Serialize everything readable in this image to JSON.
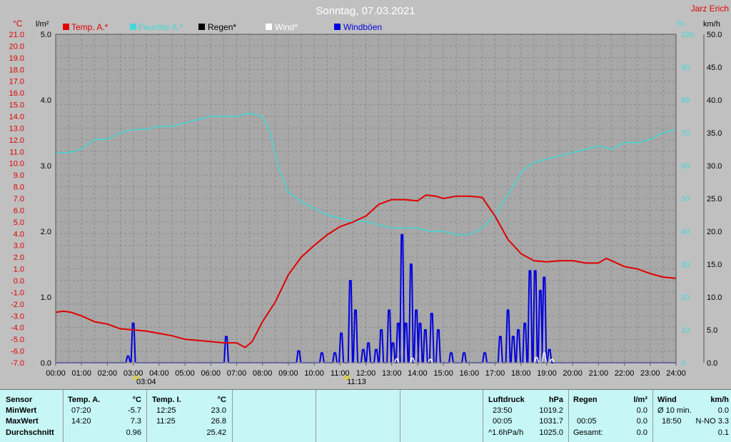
{
  "header": {
    "title": "Sonntag, 07.03.2021",
    "author": "Jarz Erich",
    "left_unit_temp": "°C",
    "left_unit_rain": "l/m²",
    "right_unit_hum": "%",
    "right_unit_wind": "km/h"
  },
  "legend": [
    {
      "label": "Temp. A.*",
      "color": "#e00000"
    },
    {
      "label": "Feuchte A.*",
      "color": "#40d8d8"
    },
    {
      "label": "Regen*",
      "color": "#000000"
    },
    {
      "label": "Wind*",
      "color": "#ffffff"
    },
    {
      "label": "Windböen",
      "color": "#0000dd"
    }
  ],
  "colors": {
    "plot_background": "#a8a8a8",
    "temperature": "#e00000",
    "humidity": "#40d8d8",
    "gusts": "#0000dd",
    "wind": "#ffffff",
    "table_background": "#c6f6f6"
  },
  "chart_data": {
    "type": "line",
    "title": "Sonntag, 07.03.2021",
    "x_ticks": [
      "00:00",
      "01:00",
      "02:00",
      "03:00",
      "04:00",
      "05:00",
      "06:00",
      "07:00",
      "08:00",
      "09:00",
      "10:00",
      "11:00",
      "12:00",
      "13:00",
      "14:00",
      "15:00",
      "16:00",
      "17:00",
      "18:00",
      "19:00",
      "20:00",
      "21:00",
      "22:00",
      "23:00",
      "24:00"
    ],
    "temp_ticks": [
      "21.0",
      "20.0",
      "19.0",
      "18.0",
      "17.0",
      "16.0",
      "15.0",
      "14.0",
      "13.0",
      "12.0",
      "11.0",
      "10.0",
      "9.0",
      "8.0",
      "7.0",
      "6.0",
      "5.0",
      "4.0",
      "3.0",
      "2.0",
      "1.0",
      "0.0",
      "-1.0",
      "-2.0",
      "-3.0",
      "-4.0",
      "-5.0",
      "-6.0",
      "-7.0"
    ],
    "rain_ticks": [
      "5.0",
      "4.0",
      "3.0",
      "2.0",
      "1.0",
      "0.0"
    ],
    "hum_ticks": [
      "100",
      "90",
      "80",
      "70",
      "60",
      "50",
      "40",
      "30",
      "20",
      "10",
      "0"
    ],
    "wind_ticks": [
      "50.0",
      "45.0",
      "40.0",
      "35.0",
      "30.0",
      "25.0",
      "20.0",
      "15.0",
      "10.0",
      "5.0",
      "0.0"
    ],
    "temp_range": [
      -7,
      21
    ],
    "rain_range": [
      0,
      5
    ],
    "hum_range": [
      0,
      100
    ],
    "wind_range": [
      0,
      50
    ],
    "x_range_hours": [
      0,
      24
    ],
    "grid": true,
    "event_markers": [
      "03:04",
      "11:13"
    ],
    "series": [
      {
        "name": "Temp. A.*",
        "axis": "temp",
        "x": [
          0,
          0.3,
          0.6,
          1,
          1.5,
          2,
          2.5,
          3,
          3.5,
          4,
          4.5,
          5,
          5.5,
          6,
          6.5,
          7,
          7.33,
          7.6,
          8,
          8.5,
          9,
          9.5,
          10,
          10.5,
          11,
          11.5,
          12,
          12.5,
          13,
          13.5,
          14,
          14.33,
          14.7,
          15,
          15.5,
          16,
          16.5,
          17,
          17.5,
          18,
          18.5,
          19,
          19.5,
          20,
          20.5,
          21,
          21.3,
          21.6,
          22,
          22.5,
          23,
          23.5,
          24
        ],
        "values": [
          -2.7,
          -2.6,
          -2.7,
          -3.0,
          -3.5,
          -3.7,
          -4.1,
          -4.2,
          -4.3,
          -4.5,
          -4.7,
          -5.0,
          -5.1,
          -5.2,
          -5.3,
          -5.3,
          -5.7,
          -5.2,
          -3.5,
          -1.8,
          0.5,
          2.0,
          3.0,
          3.9,
          4.6,
          5.0,
          5.5,
          6.5,
          6.9,
          6.9,
          6.8,
          7.3,
          7.2,
          7.0,
          7.2,
          7.2,
          7.1,
          5.5,
          3.5,
          2.3,
          1.7,
          1.6,
          1.7,
          1.7,
          1.5,
          1.5,
          1.9,
          1.6,
          1.2,
          1.0,
          0.6,
          0.3,
          0.2
        ]
      },
      {
        "name": "Feuchte A.*",
        "axis": "hum",
        "x": [
          0,
          0.5,
          1,
          1.5,
          2,
          2.5,
          3,
          3.5,
          4,
          4.5,
          5,
          5.5,
          6,
          6.5,
          7,
          7.5,
          8,
          8.3,
          8.6,
          9,
          9.5,
          10,
          10.5,
          11,
          11.5,
          12,
          12.5,
          13,
          13.5,
          14,
          14.5,
          15,
          15.5,
          16,
          16.5,
          17,
          17.5,
          18,
          18.5,
          19,
          19.5,
          20,
          20.5,
          21,
          21.5,
          22,
          22.5,
          23,
          23.5,
          24
        ],
        "values": [
          64,
          64,
          65,
          68,
          68,
          70,
          71,
          71,
          72,
          72,
          73,
          74,
          75,
          75,
          75,
          76,
          75,
          70,
          60,
          52,
          49,
          47,
          45,
          44,
          43,
          43,
          42,
          41,
          41,
          41,
          40,
          40,
          39,
          39,
          41,
          45,
          51,
          58,
          61,
          62,
          63,
          64,
          65,
          66,
          65,
          67,
          67,
          68,
          70,
          71
        ]
      },
      {
        "name": "Windböen",
        "axis": "wind",
        "bursts": [
          [
            2.8,
            1
          ],
          [
            3.0,
            6
          ],
          [
            3.2,
            0
          ],
          [
            6.6,
            4
          ],
          [
            9.4,
            1.8
          ],
          [
            10.3,
            1.5
          ],
          [
            10.8,
            1.5
          ],
          [
            11.05,
            4.5
          ],
          [
            11.4,
            12.5
          ],
          [
            11.6,
            8
          ],
          [
            11.9,
            2
          ],
          [
            12.1,
            3
          ],
          [
            12.4,
            2
          ],
          [
            12.6,
            5
          ],
          [
            12.9,
            8
          ],
          [
            13.05,
            3
          ],
          [
            13.25,
            6
          ],
          [
            13.4,
            19.5
          ],
          [
            13.55,
            6
          ],
          [
            13.75,
            15
          ],
          [
            13.95,
            8
          ],
          [
            14.1,
            6
          ],
          [
            14.3,
            5
          ],
          [
            14.55,
            7.5
          ],
          [
            14.8,
            5
          ],
          [
            15.3,
            1.5
          ],
          [
            15.8,
            1.5
          ],
          [
            16.6,
            1.5
          ],
          [
            17.2,
            4
          ],
          [
            17.5,
            8
          ],
          [
            17.7,
            4
          ],
          [
            17.9,
            5
          ],
          [
            18.15,
            6
          ],
          [
            18.35,
            14
          ],
          [
            18.55,
            14
          ],
          [
            18.75,
            11
          ],
          [
            18.9,
            13
          ],
          [
            19.1,
            2
          ]
        ]
      },
      {
        "name": "Wind*",
        "axis": "wind",
        "bursts": [
          [
            13.2,
            0.6
          ],
          [
            13.8,
            0.7
          ],
          [
            14.5,
            0.5
          ],
          [
            18.6,
            0.8
          ],
          [
            18.9,
            1.5
          ],
          [
            19.2,
            0.5
          ]
        ]
      },
      {
        "name": "Regen*",
        "axis": "rain",
        "x": [
          0,
          24
        ],
        "values": [
          0,
          0
        ]
      }
    ]
  },
  "table": {
    "sensor": {
      "header": "Sensor",
      "rows": [
        "MinWert",
        "MaxWert",
        "Durchschnitt"
      ]
    },
    "temp_a": {
      "header": "Temp. A.",
      "unit": "°C",
      "times": [
        "07:20",
        "14:20",
        ""
      ],
      "values": [
        "-5.7",
        "7.3",
        "0.96"
      ]
    },
    "temp_i": {
      "header": "Temp. I.",
      "unit": "°C",
      "times": [
        "12:25",
        "11:25",
        ""
      ],
      "values": [
        "23.0",
        "26.8",
        "25.42"
      ]
    },
    "pressure": {
      "header": "Luftdruck",
      "unit": "hPa",
      "times": [
        "23:50",
        "00:05",
        "^1.6hPa/h"
      ],
      "values": [
        "1019.2",
        "1031.7",
        "1025.0"
      ]
    },
    "rain": {
      "header": "Regen",
      "unit": "l/m²",
      "times": [
        "",
        "00:05",
        "Gesamt:"
      ],
      "values": [
        "",
        "0.0",
        "0.0"
      ],
      "row1_value": "0.0"
    },
    "wind": {
      "header": "Wind",
      "unit": "km/h",
      "times": [
        "Ø 10 min.",
        "18:50",
        ""
      ],
      "values": [
        "0.0",
        "N-NO 3.3",
        "0.1"
      ]
    }
  }
}
